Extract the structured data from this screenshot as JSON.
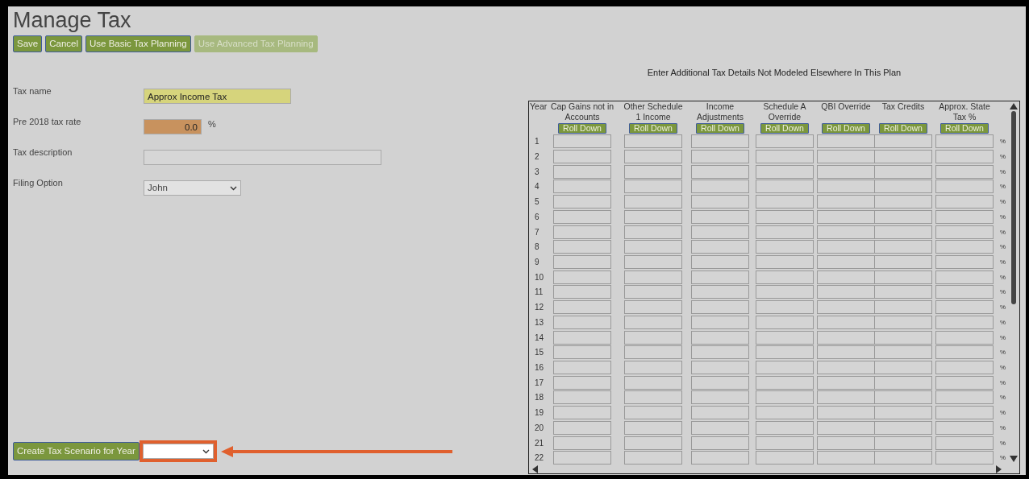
{
  "page": {
    "title": "Manage Tax"
  },
  "toolbar": [
    {
      "label": "Save",
      "disabled": false
    },
    {
      "label": "Cancel",
      "disabled": false
    },
    {
      "label": "Use Basic Tax Planning",
      "disabled": false
    },
    {
      "label": "Use Advanced Tax Planning",
      "disabled": true
    }
  ],
  "form": [
    {
      "label": "Tax name",
      "kind": "text",
      "value": "Approx Income Tax",
      "color": "#d6d47c"
    },
    {
      "label": "Pre 2018 tax rate",
      "kind": "number",
      "value": "0.0",
      "suffix": "%",
      "color": "#c8925e"
    },
    {
      "label": "Tax description",
      "kind": "long_text"
    },
    {
      "label": "Filing Option",
      "kind": "select",
      "value": "John"
    }
  ],
  "scenario": {
    "button": "Create Tax Scenario for Year"
  },
  "table": {
    "caption": "Enter Additional Tax Details Not Modeled Elsewhere In This Plan",
    "year_header": "Year",
    "columns": [
      {
        "label": "Cap Gains not in Accounts",
        "button": "Roll Down"
      },
      {
        "label": "Other Schedule 1 Income",
        "button": "Roll Down"
      },
      {
        "label": "Income Adjustments",
        "button": "Roll Down"
      },
      {
        "label": "Schedule A Override",
        "button": "Roll Down"
      },
      {
        "label": "QBI Override",
        "button": "Roll Down"
      },
      {
        "label": "Tax Credits",
        "button": "Roll Down"
      },
      {
        "label": "Approx. State Tax %",
        "button": "Roll Down"
      }
    ],
    "rows": [
      {
        "year": "1",
        "suffix": "%"
      },
      {
        "year": "2",
        "suffix": "%"
      },
      {
        "year": "3",
        "suffix": "%"
      },
      {
        "year": "4",
        "suffix": "%"
      },
      {
        "year": "5",
        "suffix": "%"
      },
      {
        "year": "6",
        "suffix": "%"
      },
      {
        "year": "7",
        "suffix": "%"
      },
      {
        "year": "8",
        "suffix": "%"
      },
      {
        "year": "9",
        "suffix": "%"
      },
      {
        "year": "10",
        "suffix": "%"
      },
      {
        "year": "11",
        "suffix": "%"
      },
      {
        "year": "12",
        "suffix": "%"
      },
      {
        "year": "13",
        "suffix": "%"
      },
      {
        "year": "14",
        "suffix": "%"
      },
      {
        "year": "15",
        "suffix": "%"
      },
      {
        "year": "16",
        "suffix": "%"
      },
      {
        "year": "17",
        "suffix": "%"
      },
      {
        "year": "18",
        "suffix": "%"
      },
      {
        "year": "19",
        "suffix": "%"
      },
      {
        "year": "20",
        "suffix": "%"
      },
      {
        "year": "21",
        "suffix": "%"
      },
      {
        "year": "22",
        "suffix": "%"
      }
    ]
  }
}
